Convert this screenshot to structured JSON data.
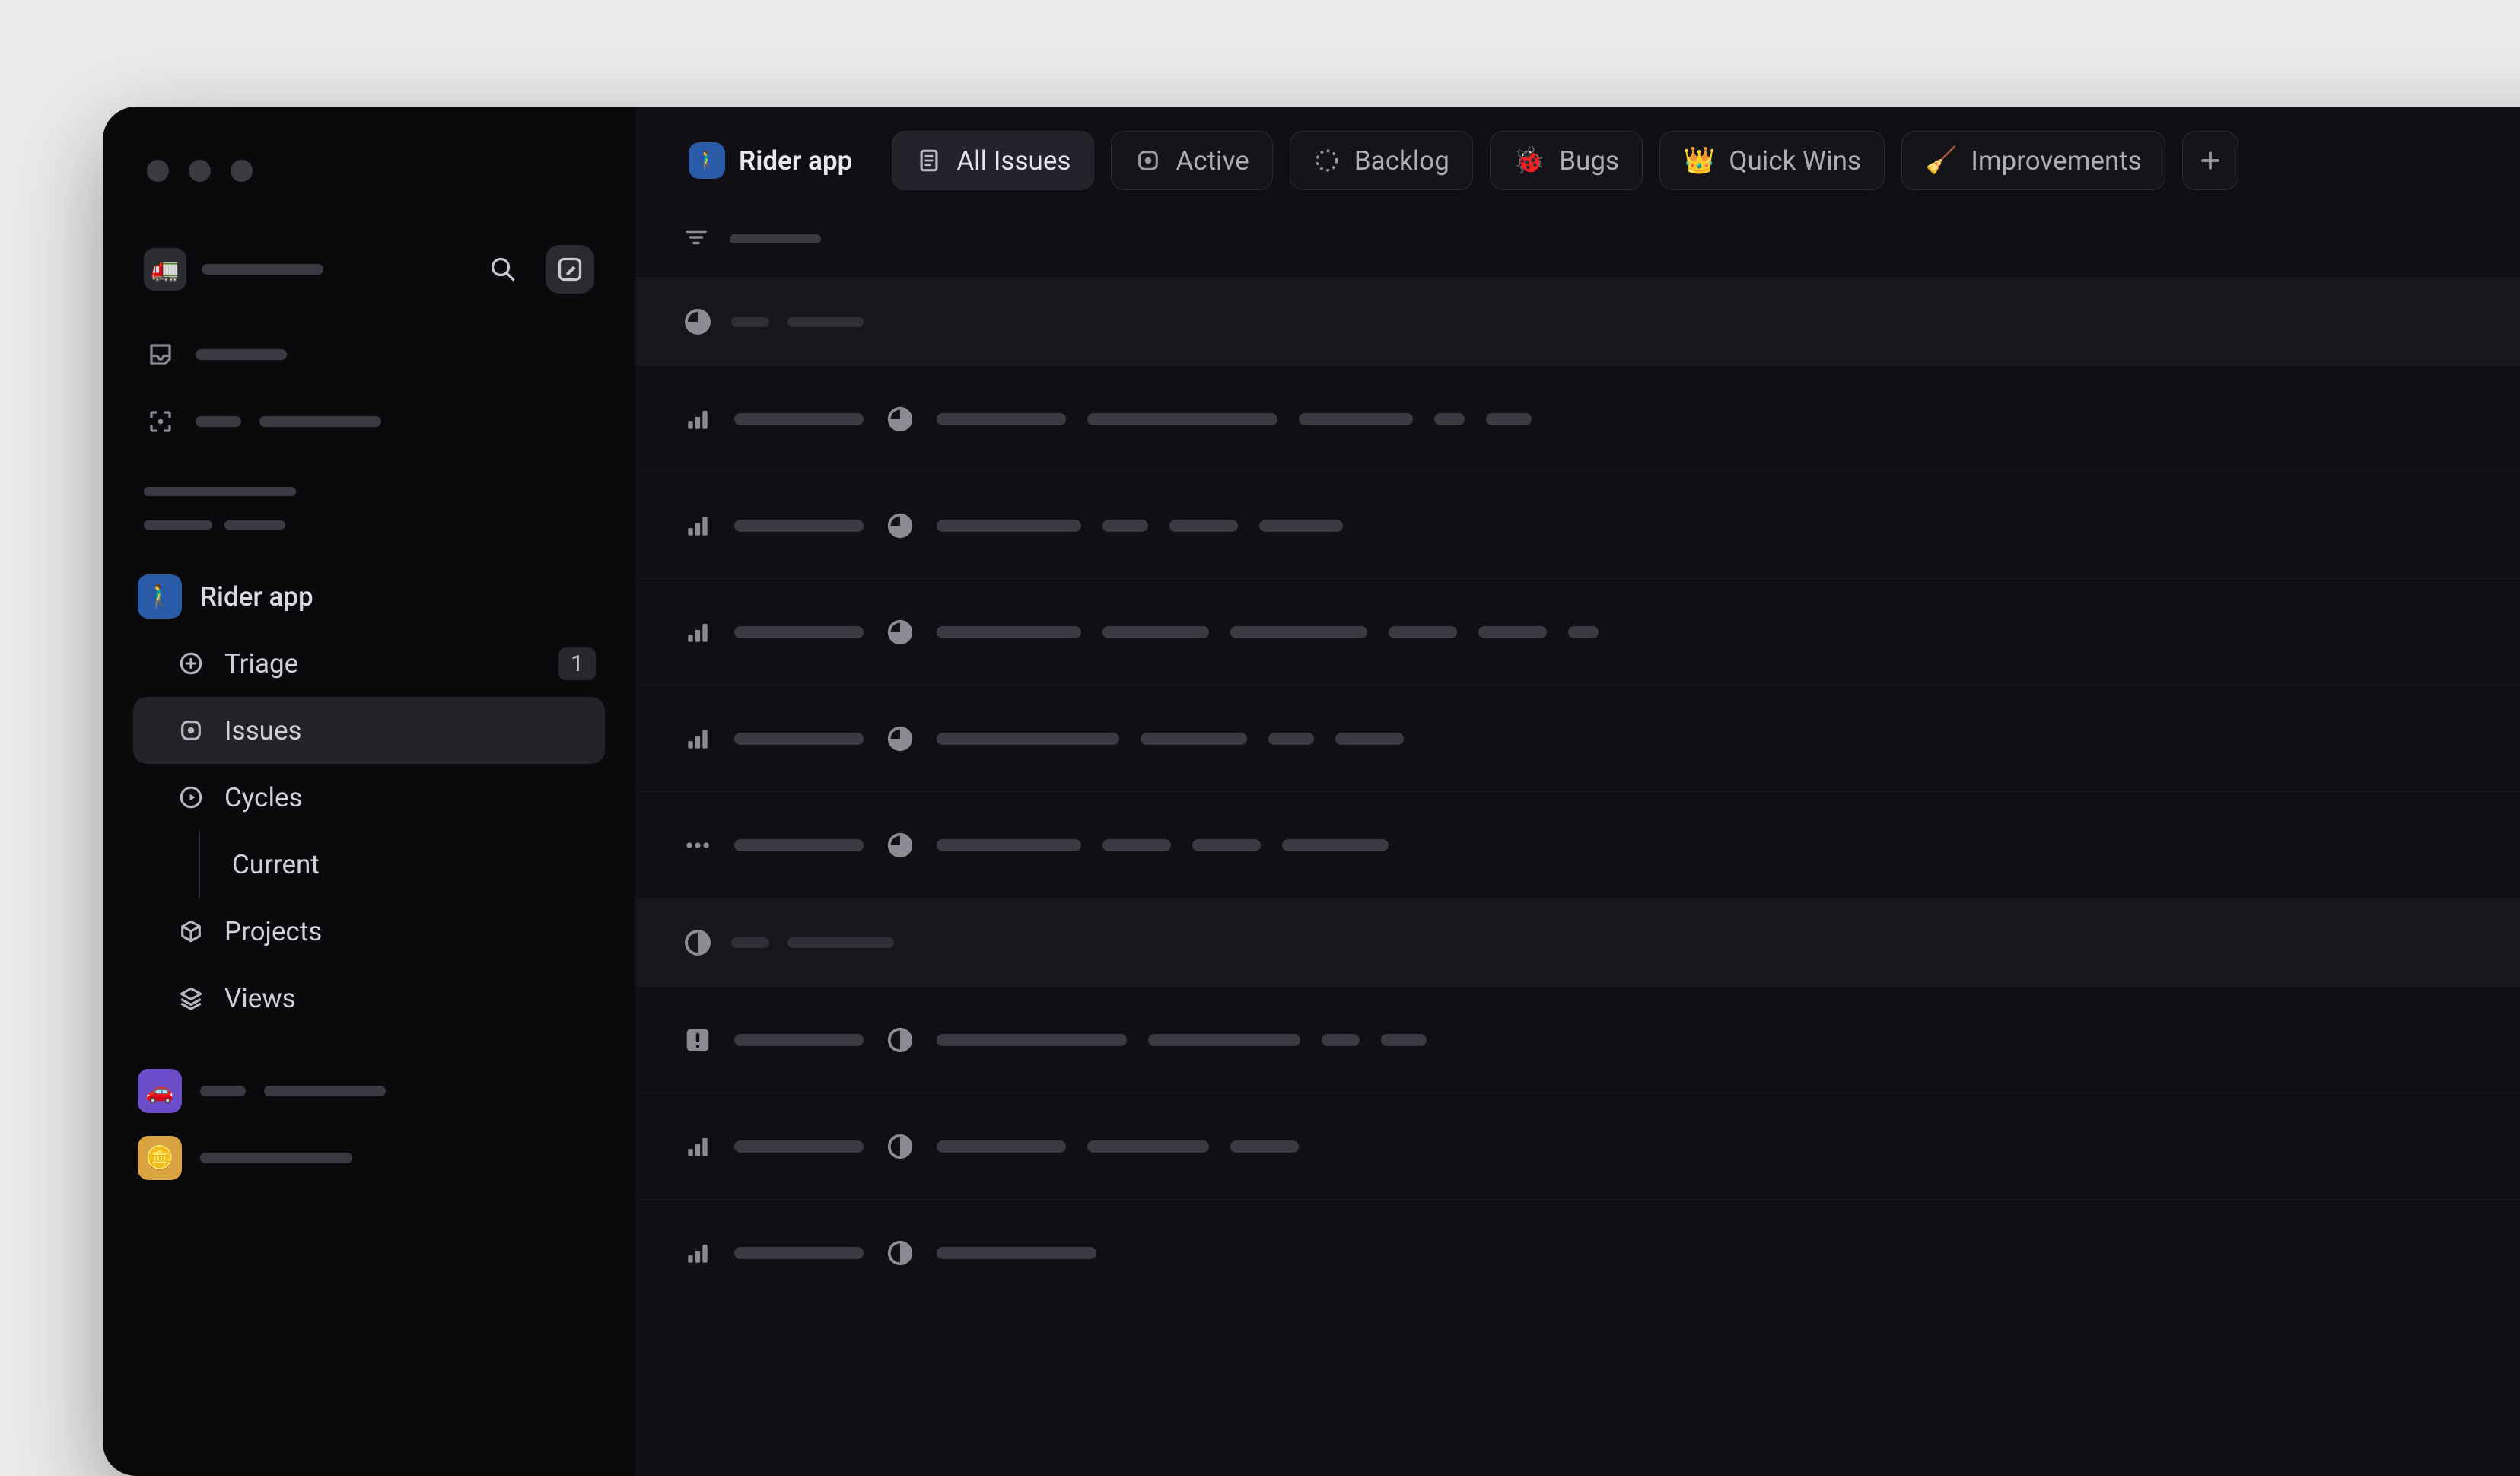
{
  "team": {
    "name": "Rider app"
  },
  "sidebar": {
    "items": {
      "triage": {
        "label": "Triage",
        "badge": "1"
      },
      "issues": {
        "label": "Issues"
      },
      "cycles": {
        "label": "Cycles",
        "current": "Current"
      },
      "projects": {
        "label": "Projects"
      },
      "views": {
        "label": "Views"
      }
    }
  },
  "tabs": {
    "team": {
      "label": "Rider app"
    },
    "all": {
      "label": "All Issues"
    },
    "active": {
      "label": "Active"
    },
    "backlog": {
      "label": "Backlog"
    },
    "bugs": {
      "label": "Bugs"
    },
    "quickwins": {
      "label": "Quick Wins"
    },
    "improvements": {
      "label": "Improvements"
    }
  }
}
